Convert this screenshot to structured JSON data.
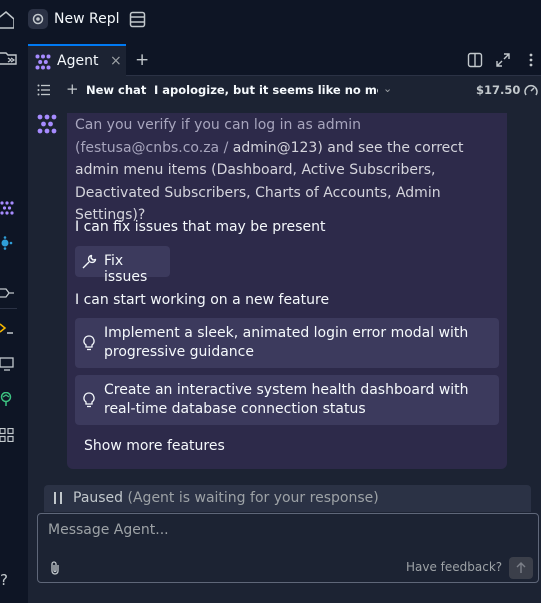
{
  "topbar": {
    "repl_name": "New Repl"
  },
  "tab": {
    "label": "Agent",
    "close": "×",
    "add": "+"
  },
  "toolbar": {
    "new_chat": "New chat",
    "chat_title": "I apologize, but it seems like no messa...",
    "cost": "$17.50"
  },
  "message": {
    "line_part1": "Can you verify if you can log in as admin (festusa@cnbs.co.za /",
    "line_part2": "admin@123) and see the correct admin menu items (Dashboard, Active Subscribers, Deactivated Subscribers, Charts of Accounts, Admin Settings)?"
  },
  "fix": {
    "heading": "I can fix issues that may be present",
    "button": "Fix issues"
  },
  "features": {
    "heading": "I can start working on a new feature",
    "items": [
      "Implement a sleek, animated login error modal with progressive guidance",
      "Create an interactive system health dashboard with real-time database connection status"
    ],
    "more": "Show more features"
  },
  "status": {
    "paused": "Paused",
    "paused_note": "(Agent is waiting for your response)"
  },
  "input": {
    "placeholder": "Message Agent...",
    "feedback": "Have feedback?"
  },
  "rail": {
    "help": "?"
  },
  "colors": {
    "background": "#0e1525",
    "panel": "#1c2333",
    "agent_card": "#2d2a4a",
    "suggestion": "#3c3a5d",
    "accent": "#0079f2",
    "agent_purple": "#a68bff"
  }
}
